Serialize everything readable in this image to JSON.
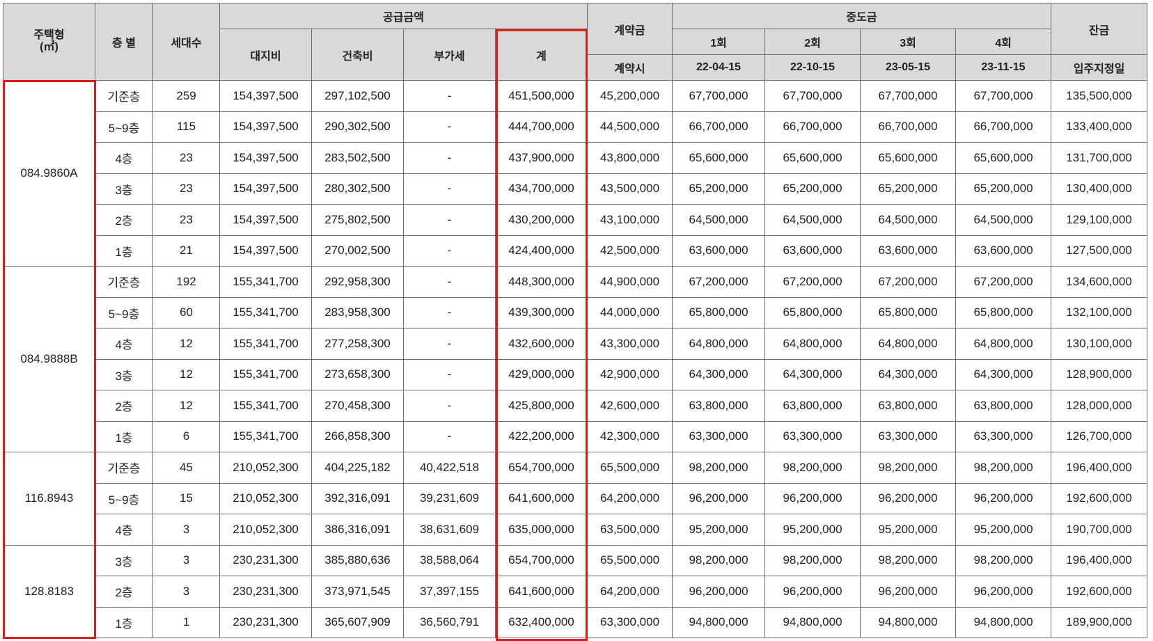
{
  "headers": {
    "type": "주택형\n(㎡)",
    "floor": "층 별",
    "units": "세대수",
    "supply": "공급금액",
    "land": "대지비",
    "building": "건축비",
    "vat": "부가세",
    "total": "계",
    "deposit": "계약금",
    "deposit_when": "계약시",
    "middle": "중도금",
    "installments": [
      {
        "label": "1회",
        "date": "22-04-15"
      },
      {
        "label": "2회",
        "date": "22-10-15"
      },
      {
        "label": "3회",
        "date": "23-05-15"
      },
      {
        "label": "4회",
        "date": "23-11-15"
      }
    ],
    "balance": "잔금",
    "balance_when": "입주지정일"
  },
  "groups": [
    {
      "type": "084.9860A",
      "rows": [
        {
          "floor": "기준층",
          "units": "259",
          "land": "154,397,500",
          "building": "297,102,500",
          "vat": "-",
          "total": "451,500,000",
          "deposit": "45,200,000",
          "mid": [
            "67,700,000",
            "67,700,000",
            "67,700,000",
            "67,700,000"
          ],
          "balance": "135,500,000"
        },
        {
          "floor": "5~9층",
          "units": "115",
          "land": "154,397,500",
          "building": "290,302,500",
          "vat": "-",
          "total": "444,700,000",
          "deposit": "44,500,000",
          "mid": [
            "66,700,000",
            "66,700,000",
            "66,700,000",
            "66,700,000"
          ],
          "balance": "133,400,000"
        },
        {
          "floor": "4층",
          "units": "23",
          "land": "154,397,500",
          "building": "283,502,500",
          "vat": "-",
          "total": "437,900,000",
          "deposit": "43,800,000",
          "mid": [
            "65,600,000",
            "65,600,000",
            "65,600,000",
            "65,600,000"
          ],
          "balance": "131,700,000"
        },
        {
          "floor": "3층",
          "units": "23",
          "land": "154,397,500",
          "building": "280,302,500",
          "vat": "-",
          "total": "434,700,000",
          "deposit": "43,500,000",
          "mid": [
            "65,200,000",
            "65,200,000",
            "65,200,000",
            "65,200,000"
          ],
          "balance": "130,400,000"
        },
        {
          "floor": "2층",
          "units": "23",
          "land": "154,397,500",
          "building": "275,802,500",
          "vat": "-",
          "total": "430,200,000",
          "deposit": "43,100,000",
          "mid": [
            "64,500,000",
            "64,500,000",
            "64,500,000",
            "64,500,000"
          ],
          "balance": "129,100,000"
        },
        {
          "floor": "1층",
          "units": "21",
          "land": "154,397,500",
          "building": "270,002,500",
          "vat": "-",
          "total": "424,400,000",
          "deposit": "42,500,000",
          "mid": [
            "63,600,000",
            "63,600,000",
            "63,600,000",
            "63,600,000"
          ],
          "balance": "127,500,000"
        }
      ]
    },
    {
      "type": "084.9888B",
      "rows": [
        {
          "floor": "기준층",
          "units": "192",
          "land": "155,341,700",
          "building": "292,958,300",
          "vat": "-",
          "total": "448,300,000",
          "deposit": "44,900,000",
          "mid": [
            "67,200,000",
            "67,200,000",
            "67,200,000",
            "67,200,000"
          ],
          "balance": "134,600,000"
        },
        {
          "floor": "5~9층",
          "units": "60",
          "land": "155,341,700",
          "building": "283,958,300",
          "vat": "-",
          "total": "439,300,000",
          "deposit": "44,000,000",
          "mid": [
            "65,800,000",
            "65,800,000",
            "65,800,000",
            "65,800,000"
          ],
          "balance": "132,100,000"
        },
        {
          "floor": "4층",
          "units": "12",
          "land": "155,341,700",
          "building": "277,258,300",
          "vat": "-",
          "total": "432,600,000",
          "deposit": "43,300,000",
          "mid": [
            "64,800,000",
            "64,800,000",
            "64,800,000",
            "64,800,000"
          ],
          "balance": "130,100,000"
        },
        {
          "floor": "3층",
          "units": "12",
          "land": "155,341,700",
          "building": "273,658,300",
          "vat": "-",
          "total": "429,000,000",
          "deposit": "42,900,000",
          "mid": [
            "64,300,000",
            "64,300,000",
            "64,300,000",
            "64,300,000"
          ],
          "balance": "128,900,000"
        },
        {
          "floor": "2층",
          "units": "12",
          "land": "155,341,700",
          "building": "270,458,300",
          "vat": "-",
          "total": "425,800,000",
          "deposit": "42,600,000",
          "mid": [
            "63,800,000",
            "63,800,000",
            "63,800,000",
            "63,800,000"
          ],
          "balance": "128,000,000"
        },
        {
          "floor": "1층",
          "units": "6",
          "land": "155,341,700",
          "building": "266,858,300",
          "vat": "-",
          "total": "422,200,000",
          "deposit": "42,300,000",
          "mid": [
            "63,300,000",
            "63,300,000",
            "63,300,000",
            "63,300,000"
          ],
          "balance": "126,700,000"
        }
      ]
    },
    {
      "type": "116.8943",
      "rows": [
        {
          "floor": "기준층",
          "units": "45",
          "land": "210,052,300",
          "building": "404,225,182",
          "vat": "40,422,518",
          "total": "654,700,000",
          "deposit": "65,500,000",
          "mid": [
            "98,200,000",
            "98,200,000",
            "98,200,000",
            "98,200,000"
          ],
          "balance": "196,400,000"
        },
        {
          "floor": "5~9층",
          "units": "15",
          "land": "210,052,300",
          "building": "392,316,091",
          "vat": "39,231,609",
          "total": "641,600,000",
          "deposit": "64,200,000",
          "mid": [
            "96,200,000",
            "96,200,000",
            "96,200,000",
            "96,200,000"
          ],
          "balance": "192,600,000"
        },
        {
          "floor": "4층",
          "units": "3",
          "land": "210,052,300",
          "building": "386,316,091",
          "vat": "38,631,609",
          "total": "635,000,000",
          "deposit": "63,500,000",
          "mid": [
            "95,200,000",
            "95,200,000",
            "95,200,000",
            "95,200,000"
          ],
          "balance": "190,700,000"
        }
      ]
    },
    {
      "type": "128.8183",
      "rows": [
        {
          "floor": "3층",
          "units": "3",
          "land": "230,231,300",
          "building": "385,880,636",
          "vat": "38,588,064",
          "total": "654,700,000",
          "deposit": "65,500,000",
          "mid": [
            "98,200,000",
            "98,200,000",
            "98,200,000",
            "98,200,000"
          ],
          "balance": "196,400,000"
        },
        {
          "floor": "2층",
          "units": "3",
          "land": "230,231,300",
          "building": "373,971,545",
          "vat": "37,397,155",
          "total": "641,600,000",
          "deposit": "64,200,000",
          "mid": [
            "96,200,000",
            "96,200,000",
            "96,200,000",
            "96,200,000"
          ],
          "balance": "192,600,000"
        },
        {
          "floor": "1층",
          "units": "1",
          "land": "230,231,300",
          "building": "365,607,909",
          "vat": "36,560,791",
          "total": "632,400,000",
          "deposit": "63,300,000",
          "mid": [
            "94,800,000",
            "94,800,000",
            "94,800,000",
            "94,800,000"
          ],
          "balance": "189,900,000"
        }
      ]
    }
  ],
  "highlight_color": "#e01b1b",
  "header_bg": "#d9d9d9"
}
